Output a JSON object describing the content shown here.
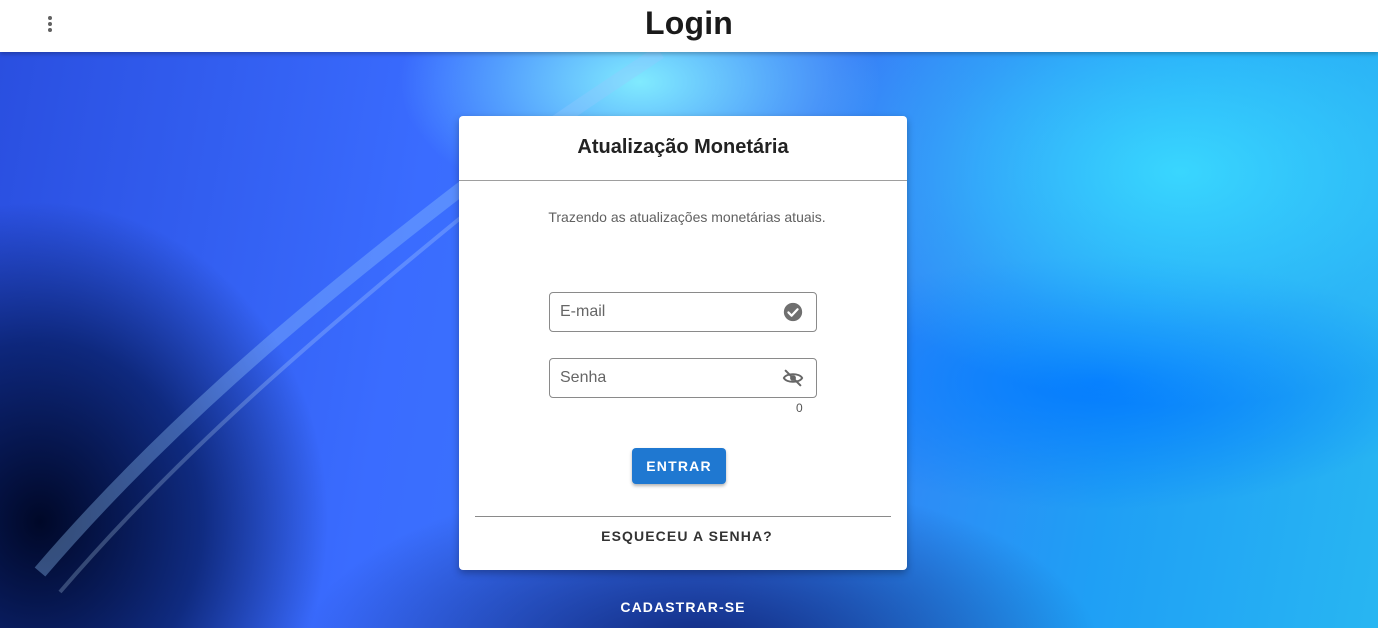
{
  "header": {
    "title": "Login",
    "menu_icon": "more-vert-icon"
  },
  "card": {
    "title": "Atualização Monetária",
    "subtitle": "Trazendo as atualizações monetárias atuais.",
    "email": {
      "placeholder": "E-mail",
      "value": "",
      "icon": "check-circle-icon"
    },
    "password": {
      "placeholder": "Senha",
      "value": "",
      "icon": "eye-off-icon",
      "counter": "0"
    },
    "submit_label": "ENTRAR",
    "forgot_label": "ESQUECEU A SENHA?"
  },
  "register_label": "CADASTRAR-SE",
  "colors": {
    "primary": "#1f78d1",
    "topbar": "#ffffff",
    "card": "#ffffff"
  }
}
